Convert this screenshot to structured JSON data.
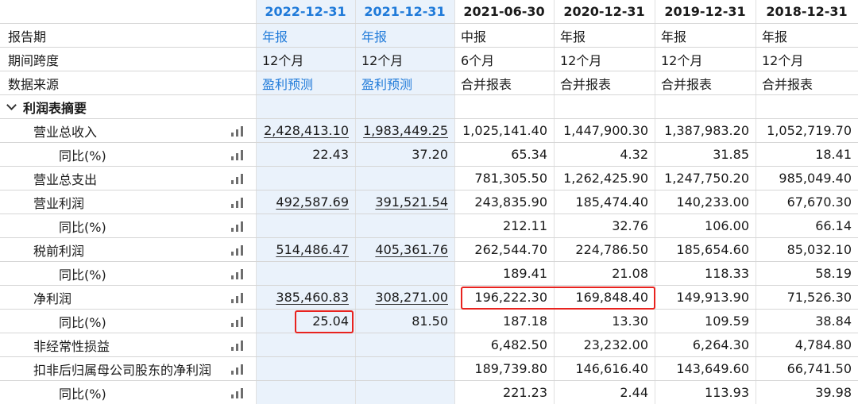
{
  "columns": [
    {
      "date": "2022-12-31",
      "type": "年报",
      "span": "12个月",
      "source": "盈利预测",
      "forecast": true
    },
    {
      "date": "2021-12-31",
      "type": "年报",
      "span": "12个月",
      "source": "盈利预测",
      "forecast": true
    },
    {
      "date": "2021-06-30",
      "type": "中报",
      "span": "6个月",
      "source": "合并报表",
      "forecast": false
    },
    {
      "date": "2020-12-31",
      "type": "年报",
      "span": "12个月",
      "source": "合并报表",
      "forecast": false
    },
    {
      "date": "2019-12-31",
      "type": "年报",
      "span": "12个月",
      "source": "合并报表",
      "forecast": false
    },
    {
      "date": "2018-12-31",
      "type": "年报",
      "span": "12个月",
      "source": "合并报表",
      "forecast": false
    }
  ],
  "labels": {
    "report_period": "报告期",
    "period_span": "期间跨度",
    "data_source": "数据来源",
    "section_title": "利润表摘要"
  },
  "rows": [
    {
      "label": "营业总收入",
      "indent": 1,
      "values": [
        "2,428,413.10",
        "1,983,449.25",
        "1,025,141.40",
        "1,447,900.30",
        "1,387,983.20",
        "1,052,719.70"
      ]
    },
    {
      "label": "同比(%)",
      "indent": 2,
      "values": [
        "22.43",
        "37.20",
        "65.34",
        "4.32",
        "31.85",
        "18.41"
      ]
    },
    {
      "label": "营业总支出",
      "indent": 1,
      "values": [
        "",
        "",
        "781,305.50",
        "1,262,425.90",
        "1,247,750.20",
        "985,049.40"
      ]
    },
    {
      "label": "营业利润",
      "indent": 1,
      "values": [
        "492,587.69",
        "391,521.54",
        "243,835.90",
        "185,474.40",
        "140,233.00",
        "67,670.30"
      ]
    },
    {
      "label": "同比(%)",
      "indent": 2,
      "values": [
        "",
        "",
        "212.11",
        "32.76",
        "106.00",
        "66.14"
      ]
    },
    {
      "label": "税前利润",
      "indent": 1,
      "values": [
        "514,486.47",
        "405,361.76",
        "262,544.70",
        "224,786.50",
        "185,654.60",
        "85,032.10"
      ]
    },
    {
      "label": "同比(%)",
      "indent": 2,
      "values": [
        "",
        "",
        "189.41",
        "21.08",
        "118.33",
        "58.19"
      ]
    },
    {
      "label": "净利润",
      "indent": 1,
      "values": [
        "385,460.83",
        "308,271.00",
        "196,222.30",
        "169,848.40",
        "149,913.90",
        "71,526.30"
      ]
    },
    {
      "label": "同比(%)",
      "indent": 2,
      "values": [
        "25.04",
        "81.50",
        "187.18",
        "13.30",
        "109.59",
        "38.84"
      ]
    },
    {
      "label": "非经常性损益",
      "indent": 1,
      "values": [
        "",
        "",
        "6,482.50",
        "23,232.00",
        "6,264.30",
        "4,784.80"
      ]
    },
    {
      "label": "扣非后归属母公司股东的净利润",
      "indent": 1,
      "values": [
        "",
        "",
        "189,739.80",
        "146,616.40",
        "143,649.60",
        "66,741.50"
      ]
    },
    {
      "label": "同比(%)",
      "indent": 2,
      "values": [
        "",
        "",
        "221.23",
        "2.44",
        "113.93",
        "39.98"
      ]
    }
  ],
  "icons": {
    "row_chart": "bar-chart-icon",
    "section_toggle": "chevron-down-icon"
  },
  "colors": {
    "forecast_blue": "#1f7ad9",
    "forecast_shade": "#eaf2fb",
    "highlight_red": "#e8231f",
    "chart_icon_gray": "#6e6e6e"
  }
}
